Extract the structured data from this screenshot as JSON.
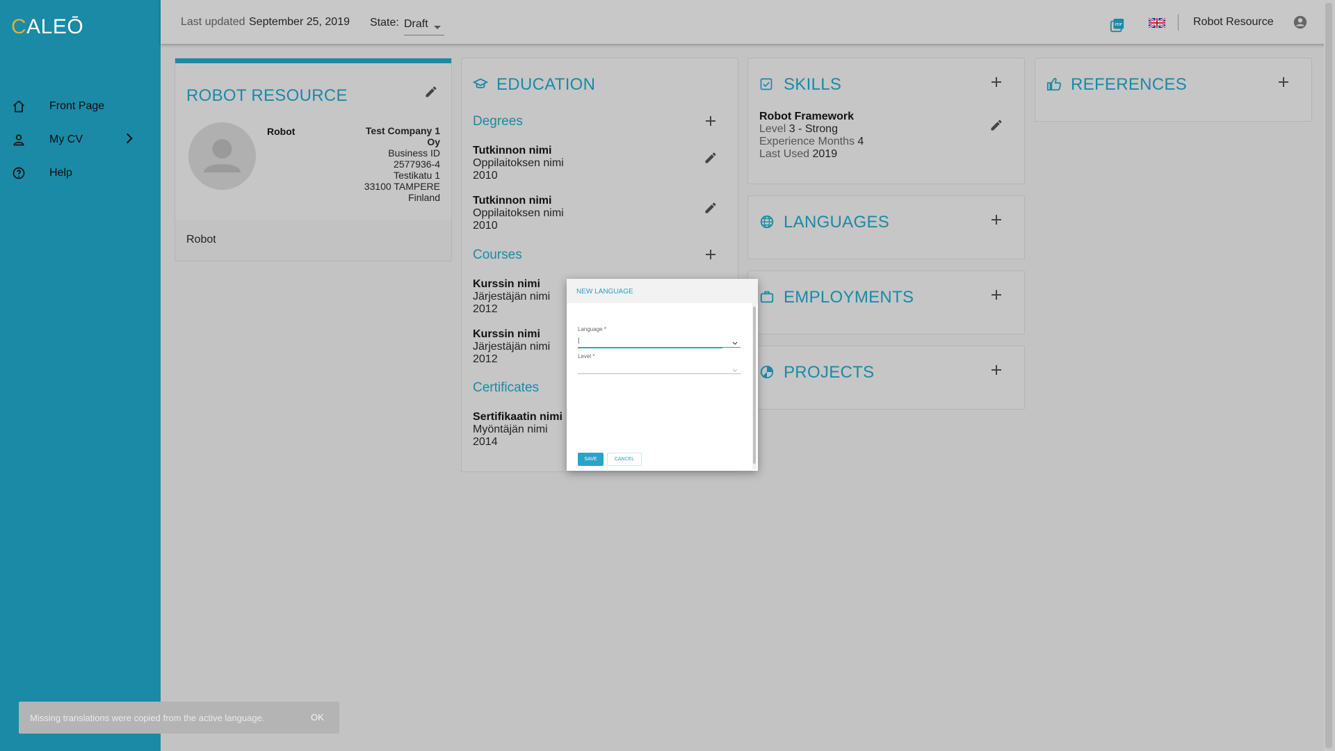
{
  "app": {
    "logo_first": "C",
    "logo_rest": "ALEŌ"
  },
  "sidebar": {
    "items": [
      {
        "label": "Front Page",
        "icon": "home-icon"
      },
      {
        "label": "My CV",
        "icon": "person-icon"
      },
      {
        "label": "Help",
        "icon": "help-circle-icon"
      }
    ]
  },
  "topbar": {
    "last_updated_label": "Last updated",
    "last_updated_value": "September 25, 2019",
    "state_label": "State:",
    "state_value": "Draft",
    "user_name": "Robot Resource"
  },
  "profile": {
    "title": "ROBOT RESOURCE",
    "first_name": "Robot",
    "company": "Test Company 1",
    "company_suffix": "Oy",
    "business_id_label": "Business ID",
    "business_id": "2577936-4",
    "street": "Testikatu 1",
    "city": "33100 TAMPERE",
    "country": "Finland",
    "footer_name": "Robot"
  },
  "education": {
    "title": "EDUCATION",
    "degrees_title": "Degrees",
    "degrees": [
      {
        "name": "Tutkinnon nimi",
        "school": "Oppilaitoksen nimi",
        "year": "2010"
      },
      {
        "name": "Tutkinnon nimi",
        "school": "Oppilaitoksen nimi",
        "year": "2010"
      }
    ],
    "courses_title": "Courses",
    "courses": [
      {
        "name": "Kurssin nimi",
        "org": "Järjestäjän nimi",
        "year": "2012"
      },
      {
        "name": "Kurssin nimi",
        "org": "Järjestäjän nimi",
        "year": "2012"
      }
    ],
    "certificates_title": "Certificates",
    "certificates": [
      {
        "name": "Sertifikaatin nimi",
        "org": "Myöntäjän nimi",
        "year": "2014"
      }
    ]
  },
  "skills": {
    "title": "SKILLS",
    "item": {
      "name": "Robot Framework",
      "level_label": "Level",
      "level_value": "3 - Strong",
      "exp_label": "Experience Months",
      "exp_value": "4",
      "last_label": "Last Used",
      "last_value": "2019"
    }
  },
  "languages": {
    "title": "LANGUAGES"
  },
  "employments": {
    "title": "EMPLOYMENTS"
  },
  "projects": {
    "title": "PROJECTS"
  },
  "references": {
    "title": "REFERENCES"
  },
  "dialog": {
    "title": "NEW LANGUAGE",
    "language_label": "Language *",
    "language_value": "|",
    "level_label": "Level *",
    "save_label": "SAVE",
    "cancel_label": "CANCEL"
  },
  "snackbar": {
    "message": "Missing translations were copied from the active language.",
    "action": "OK"
  },
  "colors": {
    "accent": "#1a8aa6",
    "logo_c": "#d8b23c",
    "dialog_accent": "#2aa3c9"
  }
}
